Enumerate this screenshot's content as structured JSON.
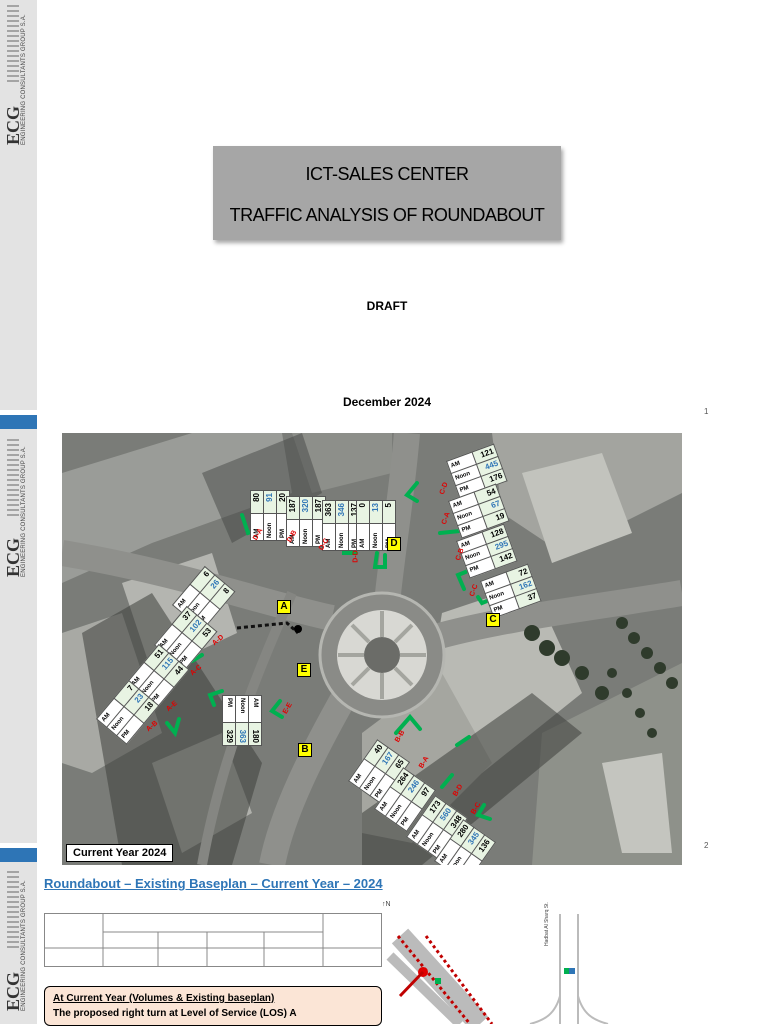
{
  "branding": {
    "logo_text": "ECG",
    "logo_subtitle": "ENGINEERING CONSULTANTS GROUP S.A."
  },
  "slide1": {
    "title_line1": "ICT-SALES CENTER",
    "title_line2": "TRAFFIC ANALYSIS OF ROUNDABOUT",
    "draft": "DRAFT",
    "date": "December 2024",
    "page_number": "1"
  },
  "slide2": {
    "page_number": "2",
    "year_label": "Current Year 2024",
    "nodes": [
      "A",
      "B",
      "C",
      "D",
      "E"
    ],
    "row_labels": [
      "AM",
      "Noon",
      "PM"
    ],
    "volume_tables": [
      {
        "values": [
          "121",
          "445",
          "176"
        ],
        "turn": "C-D"
      },
      {
        "values": [
          "54",
          "67",
          "19"
        ],
        "turn": "C-A"
      },
      {
        "values": [
          "128",
          "295",
          "142"
        ],
        "turn": "C-B"
      },
      {
        "values": [
          "72",
          "162",
          "37"
        ],
        "turn": "C-C"
      },
      {
        "values": [
          "80",
          "91",
          "20"
        ],
        "turn": "D-A"
      },
      {
        "values": [
          "187",
          "320",
          "187"
        ],
        "turn": "D-B"
      },
      {
        "values": [
          "363",
          "346",
          "137"
        ],
        "turn": "D-C"
      },
      {
        "values": [
          "0",
          "13",
          "5"
        ],
        "turn": "D-D"
      },
      {
        "values": [
          "6",
          "26",
          "8"
        ],
        "turn": "A-D"
      },
      {
        "values": [
          "37",
          "102",
          "53"
        ],
        "turn": "A-C"
      },
      {
        "values": [
          "51",
          "115",
          "44"
        ],
        "turn": "A-E"
      },
      {
        "values": [
          "7",
          "23",
          "18"
        ],
        "turn": "A-B"
      },
      {
        "values": [
          "180",
          "363",
          "329"
        ],
        "turn": "E-E"
      },
      {
        "values": [
          "40",
          "167",
          "65"
        ],
        "turn": "B-B"
      },
      {
        "values": [
          "264",
          "246",
          "97"
        ],
        "turn": "B-A"
      },
      {
        "values": [
          "173",
          "560",
          "348"
        ],
        "turn": "B-D"
      },
      {
        "values": [
          "280",
          "345",
          "136"
        ],
        "turn": "B-C"
      }
    ]
  },
  "slide3": {
    "section_title": "Roundabout – Existing Baseplan – Current Year – 2024",
    "note_heading": "At Current Year (Volumes & Existing baseplan)",
    "note_body": "The proposed right turn at Level of Service (LOS) A",
    "street_label": "Hadbat Al Sharq St."
  },
  "colors": {
    "accent": "#2e75b6",
    "title_box": "#a6a6a6",
    "node_marker": "#ffff00",
    "turn_arrow": "#00b050",
    "turn_label": "#e00000"
  }
}
